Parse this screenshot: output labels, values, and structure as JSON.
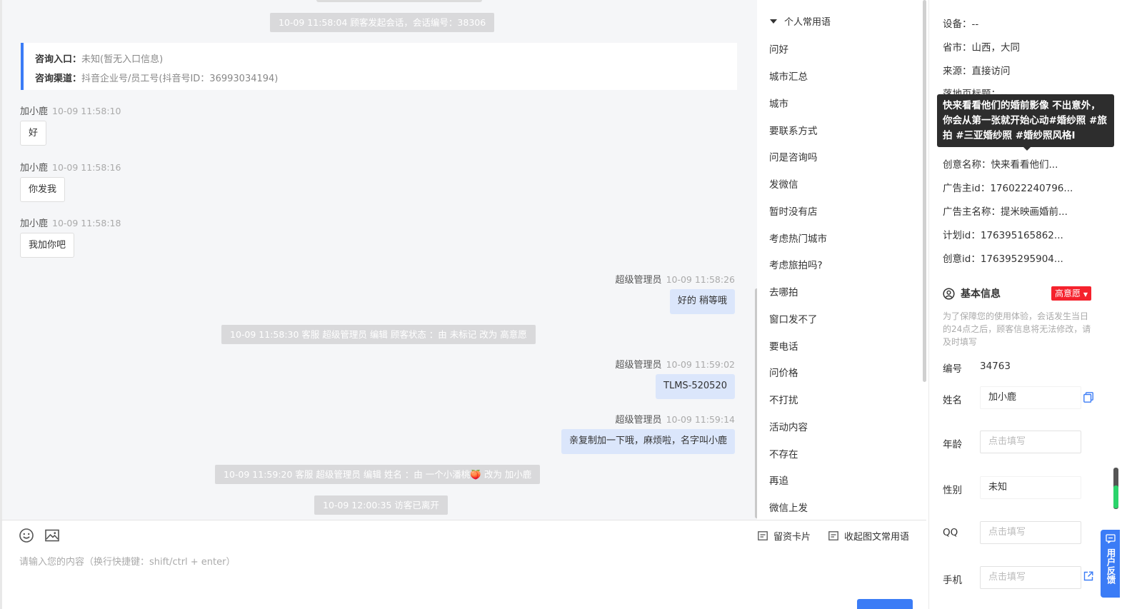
{
  "chat": {
    "system_messages": [
      "10-09 11:58:04 顾客发起会话，会话编号：38306",
      "10-09 11:58:30 客服 超级管理员 编辑 顾客状态 ：由 未标记 改为 高意愿",
      "10-09 11:59:20 客服 超级管理员 编辑 姓名 ：由 一个小潘桃🍑 改为 加小鹿",
      "10-09 12:00:35 访客已离开"
    ],
    "consult": {
      "entry_label": "咨询入口：",
      "entry_value": "未知(暂无入口信息)",
      "channel_label": "咨询渠道：",
      "channel_value": "抖音企业号/员工号(抖音号ID：36993034194)"
    },
    "messages": [
      {
        "sender": "加小鹿",
        "time": "10-09 11:58:10",
        "text": "好"
      },
      {
        "sender": "加小鹿",
        "time": "10-09 11:58:16",
        "text": "你发我"
      },
      {
        "sender": "加小鹿",
        "time": "10-09 11:58:18",
        "text": "我加你吧"
      },
      {
        "sender": "超级管理员",
        "time": "10-09 11:58:26",
        "text": "好的 稍等哦"
      },
      {
        "sender": "超级管理员",
        "time": "10-09 11:59:02",
        "text": "TLMS-520520"
      },
      {
        "sender": "超级管理员",
        "time": "10-09 11:59:14",
        "text": "亲复制加一下哦，麻烦啦，名字叫小鹿"
      }
    ]
  },
  "input": {
    "placeholder": "请输入您的内容（换行快捷键：shift/ctrl + enter）",
    "contact_card_label": "留资卡片",
    "collapse_label": "收起图文常用语",
    "emoji_icon": "smile-icon",
    "image_icon": "image-icon"
  },
  "phrases": {
    "heading": "个人常用语",
    "items": [
      "问好",
      "城市汇总",
      "城市",
      "要联系方式",
      "问是咨询吗",
      "发微信",
      "暂时没有店",
      "考虑热门城市",
      "考虑旅拍吗?",
      "去哪拍",
      "窗口发不了",
      "要电话",
      "问价格",
      "不打扰",
      "活动内容",
      "不存在",
      "再追",
      "微信上发"
    ]
  },
  "info": {
    "rows": [
      {
        "label": "设备：",
        "value": "--"
      },
      {
        "label": "省市：",
        "value": "山西，大同"
      },
      {
        "label": "来源：",
        "value": "直接访问"
      },
      {
        "label": "落地页标题：",
        "value": "--"
      },
      {
        "label": "",
        "value": ""
      },
      {
        "label": "",
        "value": ""
      },
      {
        "label": "创意名称：",
        "value": "快来看看他们..."
      },
      {
        "label": "广告主id：",
        "value": "176022240796..."
      },
      {
        "label": "广告主名称：",
        "value": "提米映画婚前..."
      },
      {
        "label": "计划id：",
        "value": "176395165862..."
      },
      {
        "label": "创意id：",
        "value": "176395295904..."
      }
    ],
    "tooltip": "快来看看他们的婚前影像 不出意外，你会从第一张就开始心动#婚纱照 #旅拍 #三亚婚纱照 #婚纱照风格I",
    "basic_title": "基本信息",
    "intent_badge": "高意愿",
    "notice": "为了保障您的使用体验，会话发生当日的24点之后，顾客信息将无法修改，请及时填写",
    "id_label": "编号",
    "id_value": "34763",
    "name_label": "姓名",
    "name_value": "加小鹿",
    "age_label": "年龄",
    "age_placeholder": "点击填写",
    "gender_label": "性别",
    "gender_value": "未知",
    "qq_label": "QQ",
    "qq_placeholder": "点击填写",
    "phone_label": "手机",
    "phone_placeholder": "点击填写"
  },
  "feedback": {
    "label": "用户反馈"
  },
  "colors": {
    "accent": "#3b7cf6",
    "badge": "#f5222d",
    "bubble_self": "#dbe6fb",
    "system": "#d9d9db"
  }
}
